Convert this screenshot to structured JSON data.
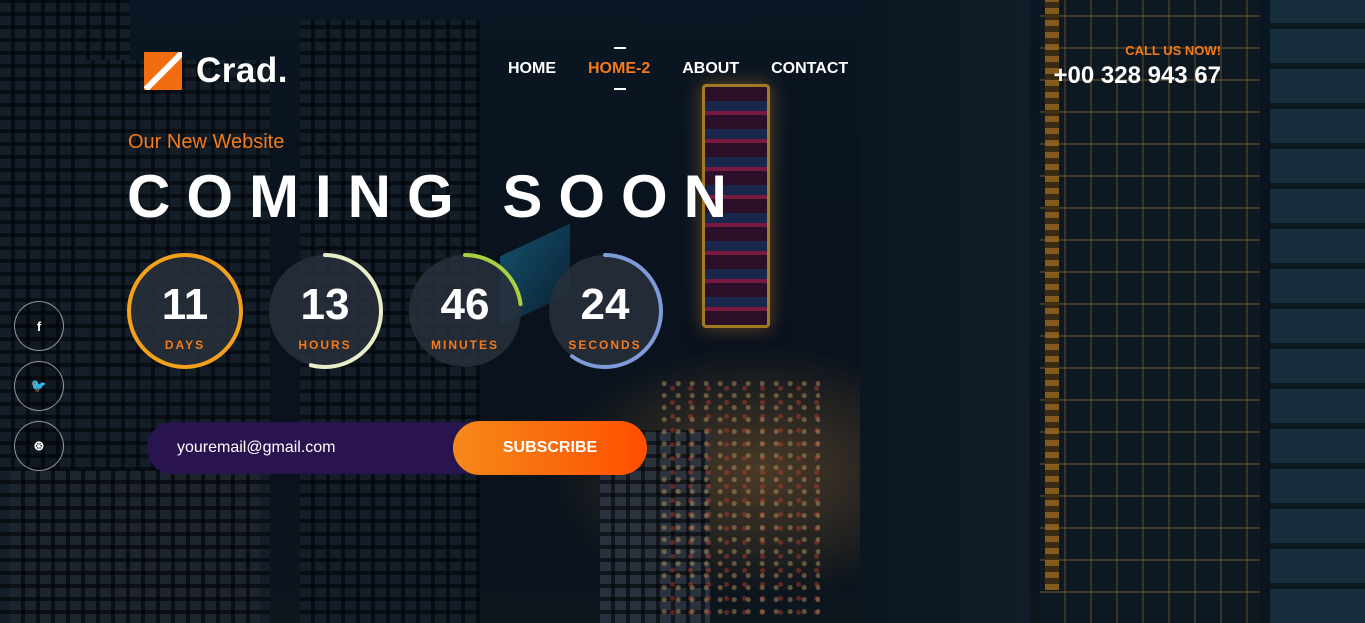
{
  "brand": {
    "name": "Crad.",
    "accent_color": "#f47a1c"
  },
  "nav": {
    "items": [
      {
        "label": "HOME",
        "active": false
      },
      {
        "label": "HOME-2",
        "active": true
      },
      {
        "label": "ABOUT",
        "active": false
      },
      {
        "label": "CONTACT",
        "active": false
      }
    ]
  },
  "contact": {
    "label": "CALL US NOW!",
    "phone": "+00 328 943 67"
  },
  "hero": {
    "tagline": "Our New Website",
    "headline": "COMING SOON"
  },
  "countdown": [
    {
      "value": "11",
      "label": "DAYS",
      "ring_color": "#f5a01a",
      "progress": 1.0
    },
    {
      "value": "13",
      "label": "HOURS",
      "ring_color": "#e8efc8",
      "progress": 0.54
    },
    {
      "value": "46",
      "label": "MINUTES",
      "ring_color": "#a8d040",
      "progress": 0.23
    },
    {
      "value": "24",
      "label": "SECONDS",
      "ring_color": "#7f9ad8",
      "progress": 0.6
    }
  ],
  "social": [
    {
      "icon": "facebook-icon",
      "glyph": "f"
    },
    {
      "icon": "twitter-icon",
      "glyph": "🐦"
    },
    {
      "icon": "dribbble-icon",
      "glyph": "⊛"
    }
  ],
  "subscribe": {
    "email_value": "youremail@gmail.com",
    "button_label": "SUBSCRIBE"
  }
}
